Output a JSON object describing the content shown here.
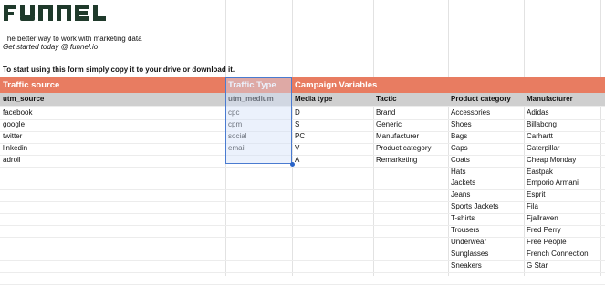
{
  "brand": {
    "logo_text": "funnel",
    "accent": "#e87c61",
    "dark": "#1f3a2b"
  },
  "intro": {
    "line1": "The better way to work with marketing data",
    "line2": "Get started today @ funnel.io",
    "instruction": "To start using this form simply copy it to your drive or download it."
  },
  "section_headers": [
    "Traffic source",
    "Traffic Type",
    "Campaign Variables"
  ],
  "column_headers": [
    "utm_source",
    "utm_medium",
    "Media type",
    "Tactic",
    "Product category",
    "Manufacturer"
  ],
  "columns": {
    "utm_source": [
      "facebook",
      "google",
      "twitter",
      "linkedin",
      "adroll"
    ],
    "utm_medium": [
      "cpc",
      "cpm",
      "social",
      "email"
    ],
    "media_type": [
      "D",
      "S",
      "PC",
      "V",
      "A"
    ],
    "tactic": [
      "Brand",
      "Generic",
      "Manufacturer",
      "Product category",
      "Remarketing"
    ],
    "product_category": [
      "Accessories",
      "Shoes",
      "Bags",
      "Caps",
      "Coats",
      "Hats",
      "Jackets",
      "Jeans",
      "Sports Jackets",
      "T-shirts",
      "Trousers",
      "Underwear",
      "Sunglasses",
      "Sneakers"
    ],
    "manufacturer": [
      "Adidas",
      "Billabong",
      "Carhartt",
      "Caterpillar",
      "Cheap Monday",
      "Eastpak",
      "Emporio Armani",
      "Esprit",
      "Fila",
      "Fjallraven",
      "Fred Perry",
      "Free People",
      "French Connection",
      "G Star"
    ]
  }
}
